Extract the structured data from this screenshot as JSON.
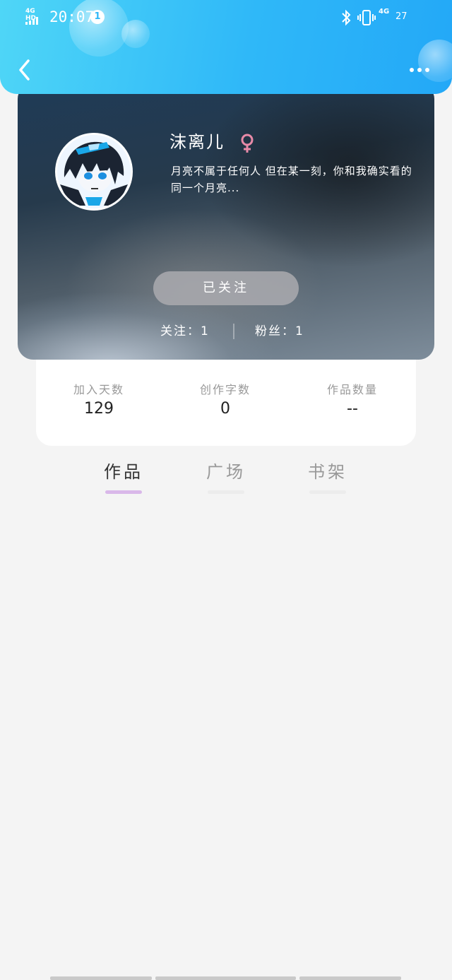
{
  "status_bar": {
    "network_label": "4G HD",
    "time": "20:07",
    "notification_count": "1",
    "net_type": "4G",
    "battery": "27"
  },
  "profile": {
    "username": "沫离儿",
    "gender": "female",
    "bio": "月亮不属于任何人 但在某一刻，你和我确实看的同一个月亮...",
    "follow_button": "已关注",
    "following": "关注：1",
    "followers": "粉丝：1"
  },
  "stats": [
    {
      "label": "加入天数",
      "value": "129"
    },
    {
      "label": "创作字数",
      "value": "0"
    },
    {
      "label": "作品数量",
      "value": "--"
    }
  ],
  "tabs": [
    {
      "label": "作品",
      "active": true
    },
    {
      "label": "广场",
      "active": false
    },
    {
      "label": "书架",
      "active": false
    }
  ],
  "colors": {
    "header_accent": "#2fb8f8",
    "tab_indicator_active": "#d9b8e9",
    "gender_icon": "#e88aa8"
  }
}
